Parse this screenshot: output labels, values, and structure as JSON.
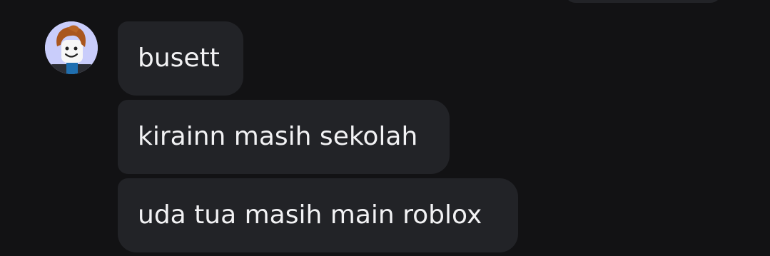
{
  "chat": {
    "messages": [
      {
        "text": "busett"
      },
      {
        "text": "kirainn masih sekolah"
      },
      {
        "text": "uda tua masih main roblox"
      }
    ],
    "avatar_icon": "roblox-bacon-hair-avatar"
  },
  "colors": {
    "background": "#121214",
    "bubble": "#222327",
    "text": "#f2f2f4",
    "avatar_bg": "#c9cdfb"
  }
}
